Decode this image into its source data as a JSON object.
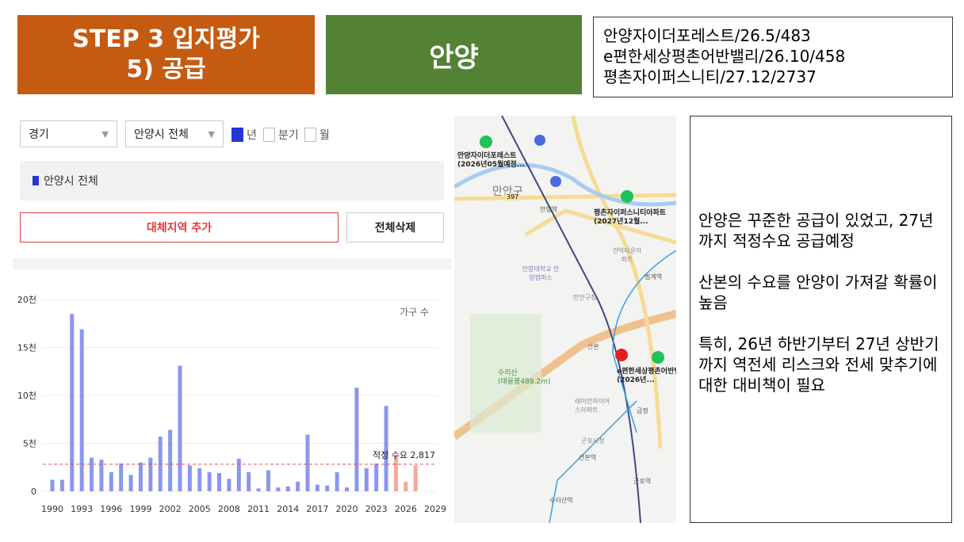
{
  "header": {
    "step_line1": "STEP 3 입지평가",
    "step_line2": "5) 공급",
    "region": "안양",
    "projects": [
      "안양자이더포레스트/26.5/483",
      "e편한세상평촌어반밸리/26.10/458",
      "평촌자이퍼스니티/27.12/2737"
    ]
  },
  "filters": {
    "province": "경기",
    "city": "안양시 전체",
    "period_options": [
      {
        "label": "년",
        "checked": true
      },
      {
        "label": "분기",
        "checked": false
      },
      {
        "label": "월",
        "checked": false
      }
    ]
  },
  "legend": {
    "label": "안양시 전체",
    "color": "#2336d6"
  },
  "buttons": {
    "add_region": "대체지역 추가",
    "delete_all": "전체삭제"
  },
  "chart_data": {
    "type": "bar",
    "title": "",
    "unit_label": "가구 수",
    "xlabel": "",
    "ylabel": "",
    "ylim": [
      0,
      20000
    ],
    "yticks": [
      {
        "v": 0,
        "label": "0"
      },
      {
        "v": 5000,
        "label": "5천"
      },
      {
        "v": 10000,
        "label": "10천"
      },
      {
        "v": 15000,
        "label": "15천"
      },
      {
        "v": 20000,
        "label": "20천"
      }
    ],
    "xticks": [
      1990,
      1993,
      1996,
      1999,
      2002,
      2005,
      2008,
      2011,
      2014,
      2017,
      2020,
      2023,
      2026,
      2029
    ],
    "x": [
      1990,
      1991,
      1992,
      1993,
      1994,
      1995,
      1996,
      1997,
      1998,
      1999,
      2000,
      2001,
      2002,
      2003,
      2004,
      2005,
      2006,
      2007,
      2008,
      2009,
      2010,
      2011,
      2012,
      2013,
      2014,
      2015,
      2016,
      2017,
      2018,
      2019,
      2020,
      2021,
      2022,
      2023,
      2024,
      2025,
      2026,
      2027
    ],
    "values": [
      1200,
      1200,
      18500,
      16900,
      3500,
      3300,
      2000,
      2900,
      1700,
      3000,
      3500,
      5700,
      6400,
      13100,
      2700,
      2400,
      2000,
      1900,
      1300,
      3400,
      2000,
      300,
      2200,
      400,
      500,
      1000,
      5900,
      700,
      600,
      2000,
      400,
      10800,
      2400,
      2900,
      8900,
      3700,
      1000,
      2700
    ],
    "forecast_from": 2025,
    "reference_line": {
      "value": 2817,
      "label": "적정 수요 2,817"
    },
    "colors": {
      "actual": "#8b96ee",
      "forecast": "#f4a99e",
      "reference": "#e0505a"
    }
  },
  "map": {
    "labels": [
      {
        "text": "안양자이더포레스트",
        "sub": "(2026년05월예정...",
        "kind": "star"
      },
      {
        "text": "평촌자이퍼스니티아파트",
        "sub": "(2027년12월...",
        "kind": "star"
      },
      {
        "text": "e편한세상평촌어반밸",
        "sub": "(2026년...",
        "kind": "star"
      },
      {
        "text": "만안구",
        "kind": "district"
      },
      {
        "text": "안양역",
        "kind": "station"
      },
      {
        "text": "관악타운아파트",
        "kind": "poi"
      },
      {
        "text": "안양대학교 안양캠퍼스",
        "kind": "poi"
      },
      {
        "text": "만안구청",
        "kind": "poi"
      },
      {
        "text": "범계역",
        "kind": "station"
      },
      {
        "text": "산본",
        "kind": "ic"
      },
      {
        "text": "수리산",
        "sub": "(태을봉489.2m)",
        "kind": "mountain"
      },
      {
        "text": "래미안하이어스아파트",
        "kind": "poi"
      },
      {
        "text": "금정",
        "kind": "ic"
      },
      {
        "text": "군포시청",
        "kind": "poi"
      },
      {
        "text": "산본역",
        "kind": "station"
      },
      {
        "text": "군포역",
        "kind": "station"
      },
      {
        "text": "수리산역",
        "kind": "station"
      },
      {
        "text": "397",
        "kind": "road"
      }
    ]
  },
  "notes": [
    "안양은 꾸준한 공급이 있었고, 27년까지 적정수요 공급예정",
    "산본의 수요를 안양이 가져갈 확률이 높음",
    "특히, 26년 하반기부터 27년 상반기까지 역전세 리스크와 전세 맞추기에 대한 대비책이 필요"
  ]
}
